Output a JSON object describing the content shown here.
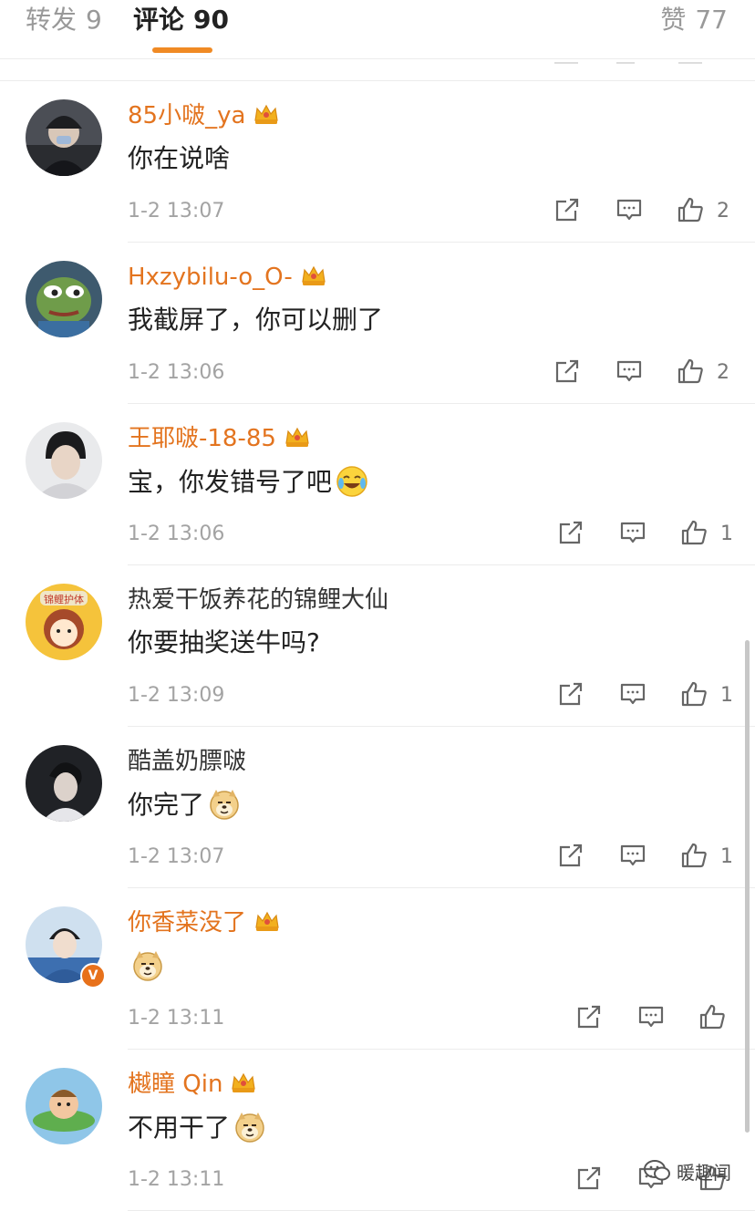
{
  "tabs": {
    "repost": {
      "label": "转发",
      "count": "9"
    },
    "comment": {
      "label": "评论",
      "count": "90"
    },
    "like": {
      "label": "赞",
      "count": "77"
    }
  },
  "comments": [
    {
      "name": "85小啵_ya",
      "text": "你在说啥",
      "time": "1-2 13:07",
      "likes": "2",
      "vip": true
    },
    {
      "name": "Hxzybilu-o_O-",
      "text": "我截屏了，你可以删了",
      "time": "1-2 13:06",
      "likes": "2",
      "vip": true
    },
    {
      "name": "王耶啵-18-85",
      "text": "宝，你发错号了吧",
      "time": "1-2 13:06",
      "likes": "1",
      "vip": true,
      "emoji": "laughing-tears-emoji"
    },
    {
      "name": "热爱干饭养花的锦鲤大仙",
      "text": "你要抽奖送牛吗?",
      "time": "1-2 13:09",
      "likes": "1",
      "vip": false,
      "avatar_text": "锦鲤护体"
    },
    {
      "name": "酷盖奶膘啵",
      "text": "你完了",
      "time": "1-2 13:07",
      "likes": "1",
      "vip": false,
      "emoji": "doge-emoji"
    },
    {
      "name": "你香菜没了",
      "text": "",
      "time": "1-2 13:11",
      "likes": "",
      "vip": true,
      "verified": true,
      "emoji": "doge-emoji"
    },
    {
      "name": "樾瞳 Qin",
      "text": "不用干了",
      "time": "1-2 13:11",
      "likes": "",
      "vip": true,
      "emoji": "doge-emoji"
    }
  ],
  "badges": {
    "verified_symbol": "V"
  },
  "watermark": {
    "text": "暖趣闻"
  },
  "colors": {
    "accent": "#f08a24",
    "vip_name": "#e3741f",
    "muted": "#a3a3a3"
  }
}
